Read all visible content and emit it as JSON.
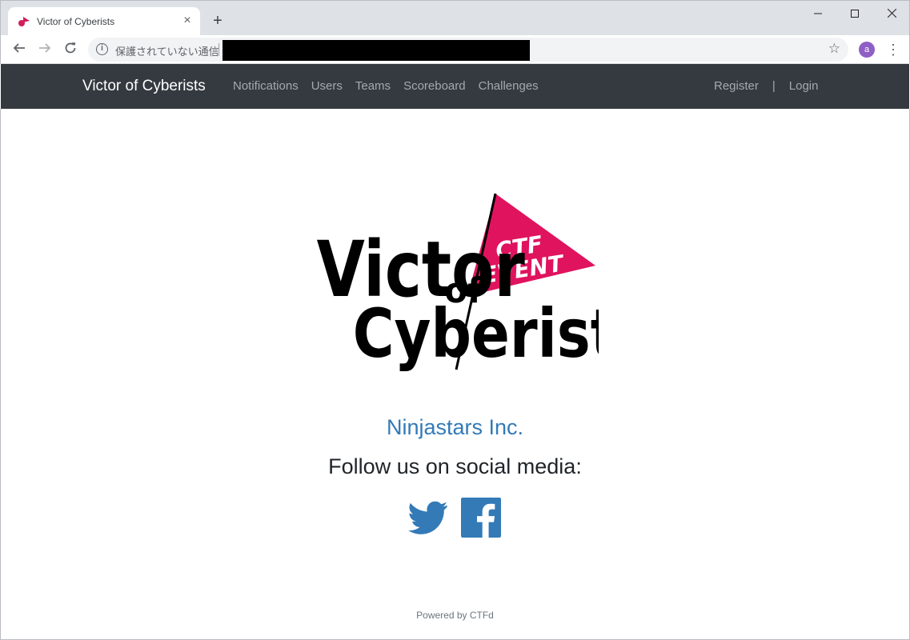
{
  "browser": {
    "tab_title": "Victor of Cyberists",
    "new_tab": "+",
    "security_text": "保護されていない通信",
    "profile_initial": "a"
  },
  "navbar": {
    "brand": "Victor of Cyberists",
    "links": [
      "Notifications",
      "Users",
      "Teams",
      "Scoreboard",
      "Challenges"
    ],
    "register": "Register",
    "separator": "|",
    "login": "Login"
  },
  "logo": {
    "line1": "Victor",
    "line2": "of",
    "line3": "Cyberists",
    "pennant_top": "CTF",
    "pennant_bottom": "EVENT",
    "pennant_color": "#e0135f"
  },
  "content": {
    "org_name": "Ninjastars Inc.",
    "follow_text": "Follow us on social media:"
  },
  "social": {
    "icons": [
      "twitter-icon",
      "facebook-icon"
    ],
    "color": "#337ab7"
  },
  "footer": {
    "powered_by": "Powered by CTFd"
  }
}
